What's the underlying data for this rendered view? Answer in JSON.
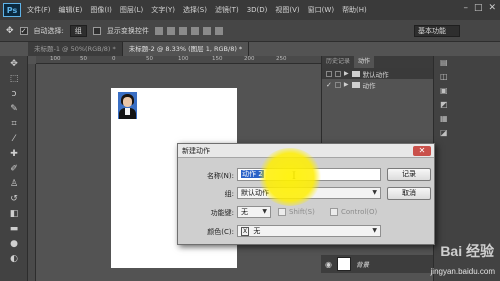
{
  "app": {
    "logo": "Ps"
  },
  "menu": [
    "文件(F)",
    "编辑(E)",
    "图像(I)",
    "图层(L)",
    "文字(Y)",
    "选择(S)",
    "滤镜(T)",
    "3D(D)",
    "视图(V)",
    "窗口(W)",
    "帮助(H)"
  ],
  "window_controls": {
    "minimize": "–",
    "maximize": "□",
    "close": "✕"
  },
  "options": {
    "auto_select_label": "自动选择:",
    "auto_select_value": "组",
    "show_transform_label": "显示变换控件",
    "workspace": "基本功能"
  },
  "tabs": [
    {
      "label": "未标题-1 @ 50%(RGB/8) *",
      "active": false
    },
    {
      "label": "未标题-2 @ 8.33% (图层 1, RGB/8) *",
      "active": true
    }
  ],
  "ruler": {
    "marks": [
      "100",
      "50",
      "0",
      "50",
      "100",
      "150",
      "200",
      "250"
    ]
  },
  "actions_panel": {
    "tabs": [
      "历史记录",
      "动作"
    ],
    "items": [
      "默认动作",
      "动作"
    ]
  },
  "layers_panel": {
    "layer_name": "背景"
  },
  "dialog": {
    "title": "新建动作",
    "name_label": "名称(N):",
    "name_value": "动作 2",
    "group_label": "组:",
    "group_value": "默认动作",
    "fkey_label": "功能键:",
    "fkey_value": "无",
    "shift_label": "Shift(S)",
    "control_label": "Control(O)",
    "color_label": "颜色(C):",
    "color_value": "无",
    "color_prefix": "X",
    "record_button": "记录",
    "cancel_button": "取消"
  },
  "watermark": {
    "brand": "Bai 经验",
    "url": "jingyan.baidu.com"
  }
}
